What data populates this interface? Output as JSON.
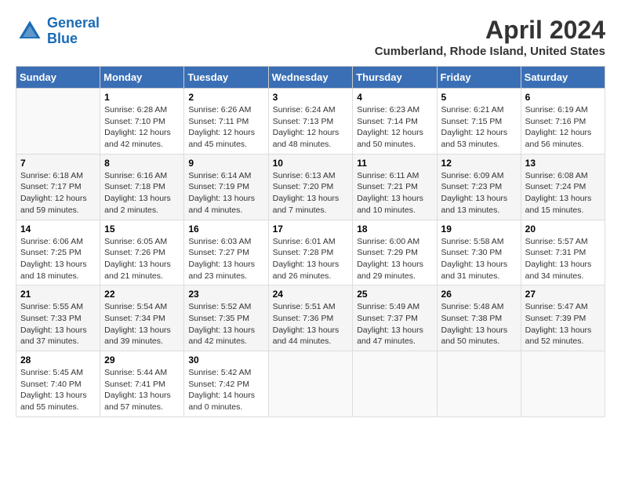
{
  "header": {
    "logo": {
      "line1": "General",
      "line2": "Blue"
    },
    "title": "April 2024",
    "subtitle": "Cumberland, Rhode Island, United States"
  },
  "calendar": {
    "days_of_week": [
      "Sunday",
      "Monday",
      "Tuesday",
      "Wednesday",
      "Thursday",
      "Friday",
      "Saturday"
    ],
    "weeks": [
      [
        {
          "day": "",
          "info": ""
        },
        {
          "day": "1",
          "info": "Sunrise: 6:28 AM\nSunset: 7:10 PM\nDaylight: 12 hours\nand 42 minutes."
        },
        {
          "day": "2",
          "info": "Sunrise: 6:26 AM\nSunset: 7:11 PM\nDaylight: 12 hours\nand 45 minutes."
        },
        {
          "day": "3",
          "info": "Sunrise: 6:24 AM\nSunset: 7:13 PM\nDaylight: 12 hours\nand 48 minutes."
        },
        {
          "day": "4",
          "info": "Sunrise: 6:23 AM\nSunset: 7:14 PM\nDaylight: 12 hours\nand 50 minutes."
        },
        {
          "day": "5",
          "info": "Sunrise: 6:21 AM\nSunset: 7:15 PM\nDaylight: 12 hours\nand 53 minutes."
        },
        {
          "day": "6",
          "info": "Sunrise: 6:19 AM\nSunset: 7:16 PM\nDaylight: 12 hours\nand 56 minutes."
        }
      ],
      [
        {
          "day": "7",
          "info": "Sunrise: 6:18 AM\nSunset: 7:17 PM\nDaylight: 12 hours\nand 59 minutes."
        },
        {
          "day": "8",
          "info": "Sunrise: 6:16 AM\nSunset: 7:18 PM\nDaylight: 13 hours\nand 2 minutes."
        },
        {
          "day": "9",
          "info": "Sunrise: 6:14 AM\nSunset: 7:19 PM\nDaylight: 13 hours\nand 4 minutes."
        },
        {
          "day": "10",
          "info": "Sunrise: 6:13 AM\nSunset: 7:20 PM\nDaylight: 13 hours\nand 7 minutes."
        },
        {
          "day": "11",
          "info": "Sunrise: 6:11 AM\nSunset: 7:21 PM\nDaylight: 13 hours\nand 10 minutes."
        },
        {
          "day": "12",
          "info": "Sunrise: 6:09 AM\nSunset: 7:23 PM\nDaylight: 13 hours\nand 13 minutes."
        },
        {
          "day": "13",
          "info": "Sunrise: 6:08 AM\nSunset: 7:24 PM\nDaylight: 13 hours\nand 15 minutes."
        }
      ],
      [
        {
          "day": "14",
          "info": "Sunrise: 6:06 AM\nSunset: 7:25 PM\nDaylight: 13 hours\nand 18 minutes."
        },
        {
          "day": "15",
          "info": "Sunrise: 6:05 AM\nSunset: 7:26 PM\nDaylight: 13 hours\nand 21 minutes."
        },
        {
          "day": "16",
          "info": "Sunrise: 6:03 AM\nSunset: 7:27 PM\nDaylight: 13 hours\nand 23 minutes."
        },
        {
          "day": "17",
          "info": "Sunrise: 6:01 AM\nSunset: 7:28 PM\nDaylight: 13 hours\nand 26 minutes."
        },
        {
          "day": "18",
          "info": "Sunrise: 6:00 AM\nSunset: 7:29 PM\nDaylight: 13 hours\nand 29 minutes."
        },
        {
          "day": "19",
          "info": "Sunrise: 5:58 AM\nSunset: 7:30 PM\nDaylight: 13 hours\nand 31 minutes."
        },
        {
          "day": "20",
          "info": "Sunrise: 5:57 AM\nSunset: 7:31 PM\nDaylight: 13 hours\nand 34 minutes."
        }
      ],
      [
        {
          "day": "21",
          "info": "Sunrise: 5:55 AM\nSunset: 7:33 PM\nDaylight: 13 hours\nand 37 minutes."
        },
        {
          "day": "22",
          "info": "Sunrise: 5:54 AM\nSunset: 7:34 PM\nDaylight: 13 hours\nand 39 minutes."
        },
        {
          "day": "23",
          "info": "Sunrise: 5:52 AM\nSunset: 7:35 PM\nDaylight: 13 hours\nand 42 minutes."
        },
        {
          "day": "24",
          "info": "Sunrise: 5:51 AM\nSunset: 7:36 PM\nDaylight: 13 hours\nand 44 minutes."
        },
        {
          "day": "25",
          "info": "Sunrise: 5:49 AM\nSunset: 7:37 PM\nDaylight: 13 hours\nand 47 minutes."
        },
        {
          "day": "26",
          "info": "Sunrise: 5:48 AM\nSunset: 7:38 PM\nDaylight: 13 hours\nand 50 minutes."
        },
        {
          "day": "27",
          "info": "Sunrise: 5:47 AM\nSunset: 7:39 PM\nDaylight: 13 hours\nand 52 minutes."
        }
      ],
      [
        {
          "day": "28",
          "info": "Sunrise: 5:45 AM\nSunset: 7:40 PM\nDaylight: 13 hours\nand 55 minutes."
        },
        {
          "day": "29",
          "info": "Sunrise: 5:44 AM\nSunset: 7:41 PM\nDaylight: 13 hours\nand 57 minutes."
        },
        {
          "day": "30",
          "info": "Sunrise: 5:42 AM\nSunset: 7:42 PM\nDaylight: 14 hours\nand 0 minutes."
        },
        {
          "day": "",
          "info": ""
        },
        {
          "day": "",
          "info": ""
        },
        {
          "day": "",
          "info": ""
        },
        {
          "day": "",
          "info": ""
        }
      ]
    ]
  }
}
